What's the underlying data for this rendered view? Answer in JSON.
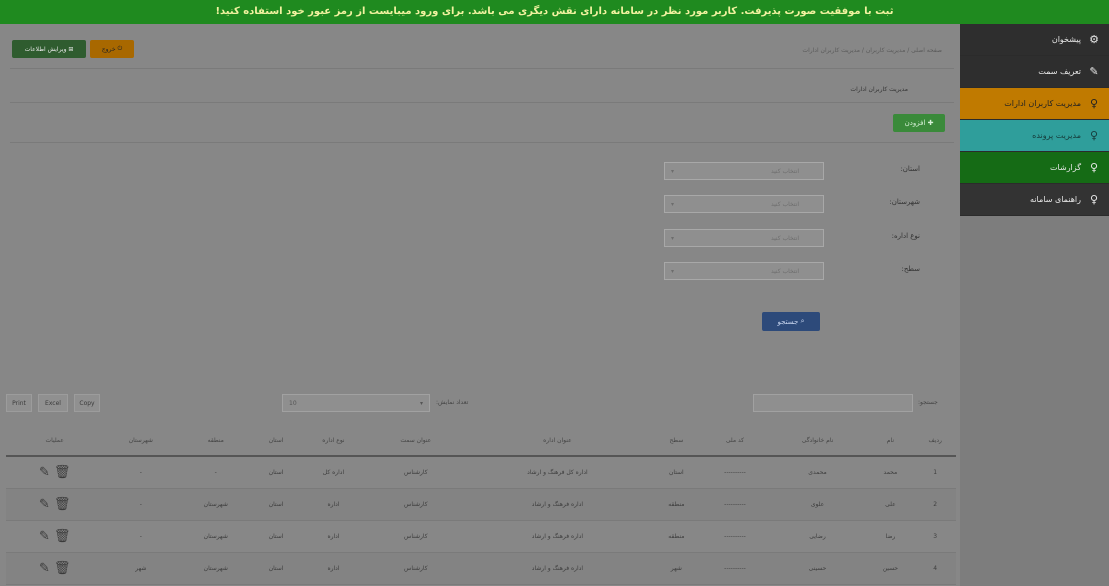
{
  "alert": {
    "text": "ثبت با موفقیت صورت پذیرفت. کاربر مورد نظر در سامانه دارای نقش دیگری می باشد. برای ورود میبایست از رمز عبور خود استفاده کنید!"
  },
  "sidebar": {
    "items": [
      {
        "label": "پیشخوان",
        "icon": "gear-icon",
        "style": "dark"
      },
      {
        "label": "تعریف سمت",
        "icon": "pin-icon",
        "style": "dark"
      },
      {
        "label": "مدیریت کاربران ادارات",
        "icon": "lightbulb-icon",
        "style": "orange"
      },
      {
        "label": "مدیریت پرونده",
        "icon": "lightbulb-icon",
        "style": "teal"
      },
      {
        "label": "گزارشات",
        "icon": "lightbulb-icon",
        "style": "green"
      },
      {
        "label": "راهنمای سامانه",
        "icon": "lightbulb-icon",
        "style": "dark2"
      }
    ]
  },
  "header": {
    "breadcrumb": "صفحه اصلی / مدیریت کاربران / مدیریت کاربران ادارات",
    "exit_label": "خروج",
    "profile_label": "ویرایش اطلاعات"
  },
  "page": {
    "title": "مدیریت کاربران ادارات",
    "add_label": "افزودن"
  },
  "filters": [
    {
      "label": "استان:",
      "placeholder": "انتخاب کنید"
    },
    {
      "label": "شهرستان:",
      "placeholder": "انتخاب کنید"
    },
    {
      "label": "نوع اداره:",
      "placeholder": "انتخاب کنید"
    },
    {
      "label": "سطح:",
      "placeholder": "انتخاب کنید"
    }
  ],
  "search_button": "جستجو",
  "table_toolbar": {
    "search_label": "جستجو:",
    "page_size_label": "تعداد نمایش:",
    "page_size_value": "10",
    "exports": [
      "Copy",
      "Excel",
      "Print"
    ]
  },
  "table": {
    "columns": [
      "ردیف",
      "نام",
      "نام خانوادگی",
      "کد ملی",
      "سطح",
      "عنوان اداره",
      "عنوان سمت",
      "نوع اداره",
      "استان",
      "منطقه",
      "شهرستان",
      "عملیات"
    ],
    "rows": [
      [
        "1",
        "محمد",
        "محمدی",
        "----------",
        "استان",
        "اداره کل فرهنگ و ارشاد",
        "کارشناس",
        "اداره کل",
        "استان",
        "-",
        "-",
        ""
      ],
      [
        "2",
        "علی",
        "علوی",
        "----------",
        "منطقه",
        "اداره فرهنگ و ارشاد",
        "کارشناس",
        "اداره",
        "استان",
        "شهرستان",
        "-",
        ""
      ],
      [
        "3",
        "رضا",
        "رضایی",
        "----------",
        "منطقه",
        "اداره فرهنگ و ارشاد",
        "کارشناس",
        "اداره",
        "استان",
        "شهرستان",
        "-",
        ""
      ],
      [
        "4",
        "حسین",
        "حسینی",
        "----------",
        "شهر",
        "اداره فرهنگ و ارشاد",
        "کارشناس",
        "اداره",
        "استان",
        "شهرستان",
        "شهر",
        ""
      ]
    ]
  }
}
